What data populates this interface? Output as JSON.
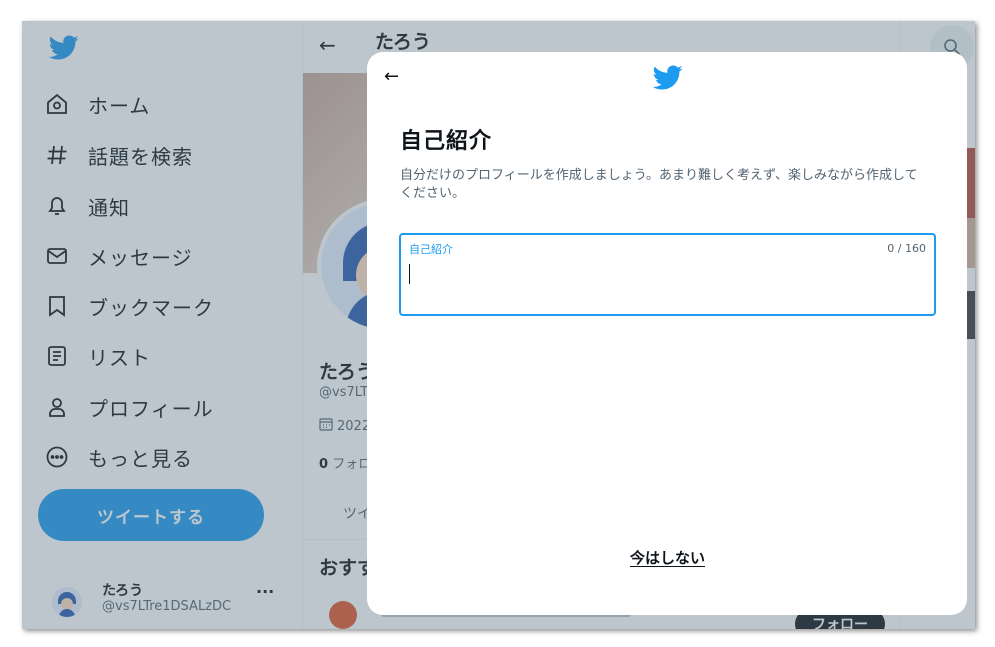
{
  "sidebar": {
    "logo_icon": "twitter-bird-icon",
    "items": [
      {
        "label": "ホーム",
        "icon": "home-icon"
      },
      {
        "label": "話題を検索",
        "icon": "hashtag-icon"
      },
      {
        "label": "通知",
        "icon": "bell-icon"
      },
      {
        "label": "メッセージ",
        "icon": "envelope-icon"
      },
      {
        "label": "ブックマーク",
        "icon": "bookmark-icon"
      },
      {
        "label": "リスト",
        "icon": "list-icon"
      },
      {
        "label": "プロフィール",
        "icon": "person-icon"
      },
      {
        "label": "もっと見る",
        "icon": "more-circle-icon"
      }
    ],
    "tweet_button": "ツイートする",
    "account": {
      "name": "たろう",
      "handle": "@vs7LTre1DSALzDC",
      "more": "···"
    }
  },
  "profile": {
    "header_title": "たろう",
    "name": "たろう",
    "handle": "@vs7LT",
    "joined": "2022",
    "follows": {
      "count": "0",
      "label": "フォロー"
    },
    "tab": "ツイ",
    "recommend_heading": "おすす",
    "follow_button": "フォロー"
  },
  "modal": {
    "title": "自己紹介",
    "description": "自分だけのプロフィールを作成しましょう。あまり難しく考えず、楽しみながら作成してください。",
    "bio_label": "自己紹介",
    "bio_value": "",
    "bio_counter": "0 / 160",
    "skip_label": "今はしない"
  },
  "colors": {
    "brand": "#1d9bf0",
    "text": "#0f1419",
    "muted": "#536471",
    "overlay": "rgba(91,112,131,0.4)"
  }
}
